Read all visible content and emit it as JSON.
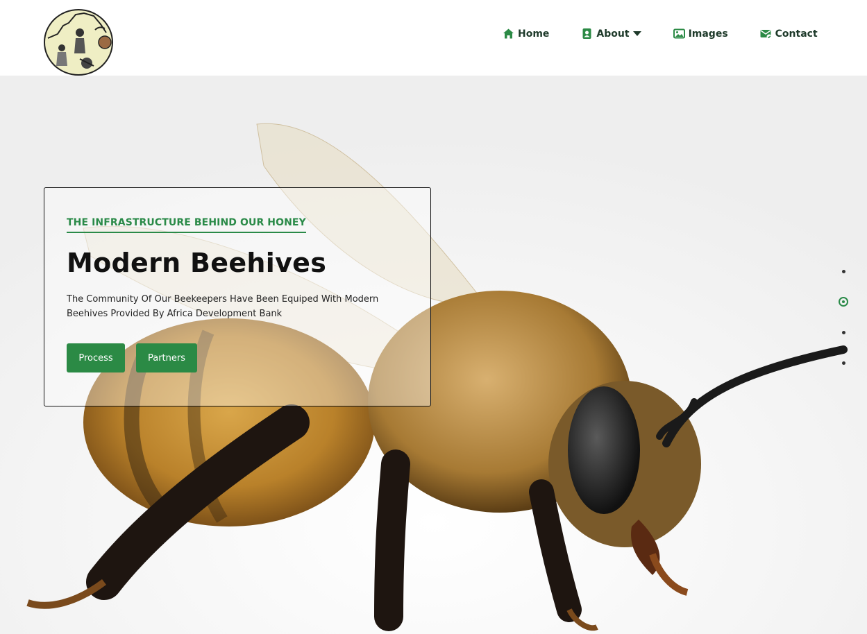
{
  "nav": {
    "items": [
      {
        "label": "Home",
        "icon": "home-icon"
      },
      {
        "label": "About",
        "icon": "person-badge-icon",
        "dropdown": true
      },
      {
        "label": "Images",
        "icon": "image-icon"
      },
      {
        "label": "Contact",
        "icon": "mail-check-icon"
      }
    ]
  },
  "hero": {
    "eyebrow": "THE INFRASTRUCTURE BEHIND OUR HONEY",
    "title": "Modern Beehives",
    "description": "The Community Of Our Beekeepers Have Been Equiped With Modern Beehives Provided By Africa Development Bank",
    "buttons": {
      "process": "Process",
      "partners": "Partners"
    },
    "slides": {
      "count": 4,
      "active_index": 1
    }
  },
  "colors": {
    "accent": "#2b8a45",
    "nav_text": "#1e3a2a"
  }
}
